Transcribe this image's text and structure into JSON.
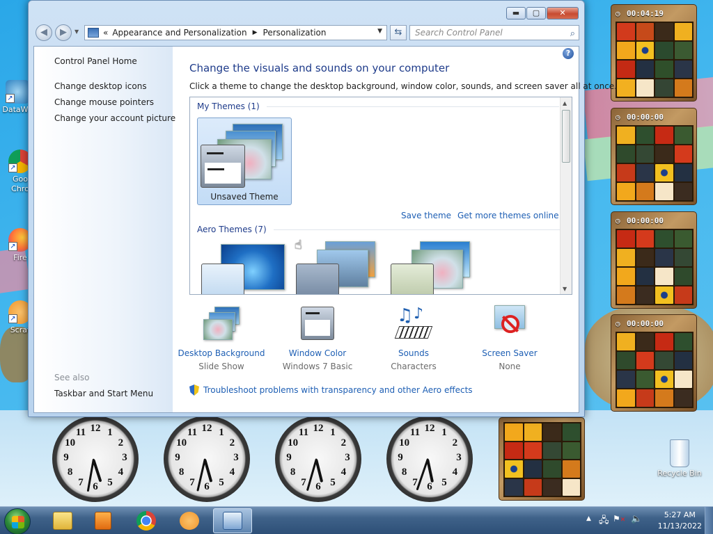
{
  "desktop": {
    "icons": [
      {
        "label": "DataWa"
      },
      {
        "label": "Goo Chro"
      },
      {
        "label": "Fire"
      },
      {
        "label": "Scrat"
      }
    ],
    "recycle_bin": "Recycle Bin"
  },
  "window": {
    "caption": {
      "minimize": "▬",
      "maximize": "▢",
      "close": "✕"
    },
    "breadcrumb": [
      "Appearance and Personalization",
      "Personalization"
    ],
    "breadcrumb_prefix": "«",
    "search_placeholder": "Search Control Panel"
  },
  "sidebar": {
    "home": "Control Panel Home",
    "links": [
      "Change desktop icons",
      "Change mouse pointers",
      "Change your account picture"
    ],
    "see_also": "See also",
    "see_also_links": [
      "Taskbar and Start Menu"
    ]
  },
  "main": {
    "title": "Change the visuals and sounds on your computer",
    "subtitle": "Click a theme to change the desktop background, window color, sounds, and screen saver all at once.",
    "my_themes_header": "My Themes (1)",
    "unsaved_theme_label": "Unsaved Theme",
    "save_theme": "Save theme",
    "get_more_themes": "Get more themes online",
    "aero_themes_header": "Aero Themes (7)",
    "options": [
      {
        "title": "Desktop Background",
        "value": "Slide Show"
      },
      {
        "title": "Window Color",
        "value": "Windows 7 Basic"
      },
      {
        "title": "Sounds",
        "value": "Characters"
      },
      {
        "title": "Screen Saver",
        "value": "None"
      }
    ],
    "troubleshoot": "Troubleshoot problems with transparency and other Aero effects"
  },
  "gadgets": {
    "puzzles": [
      {
        "timer": "00:04:19"
      },
      {
        "timer": "00:00:00"
      },
      {
        "timer": "00:00:00"
      },
      {
        "timer": "00:00:00"
      }
    ],
    "clocks": [
      {
        "numerals": [
          "12",
          "1",
          "2",
          "3",
          "4",
          "5",
          "6",
          "7",
          "8",
          "9",
          "10",
          "11"
        ]
      }
    ]
  },
  "taskbar": {
    "time": "5:27 AM",
    "date": "11/13/2022"
  },
  "colors": {
    "link": "#1e5fb4",
    "title": "#1e3b8a",
    "desktop": "#45b8ef"
  }
}
